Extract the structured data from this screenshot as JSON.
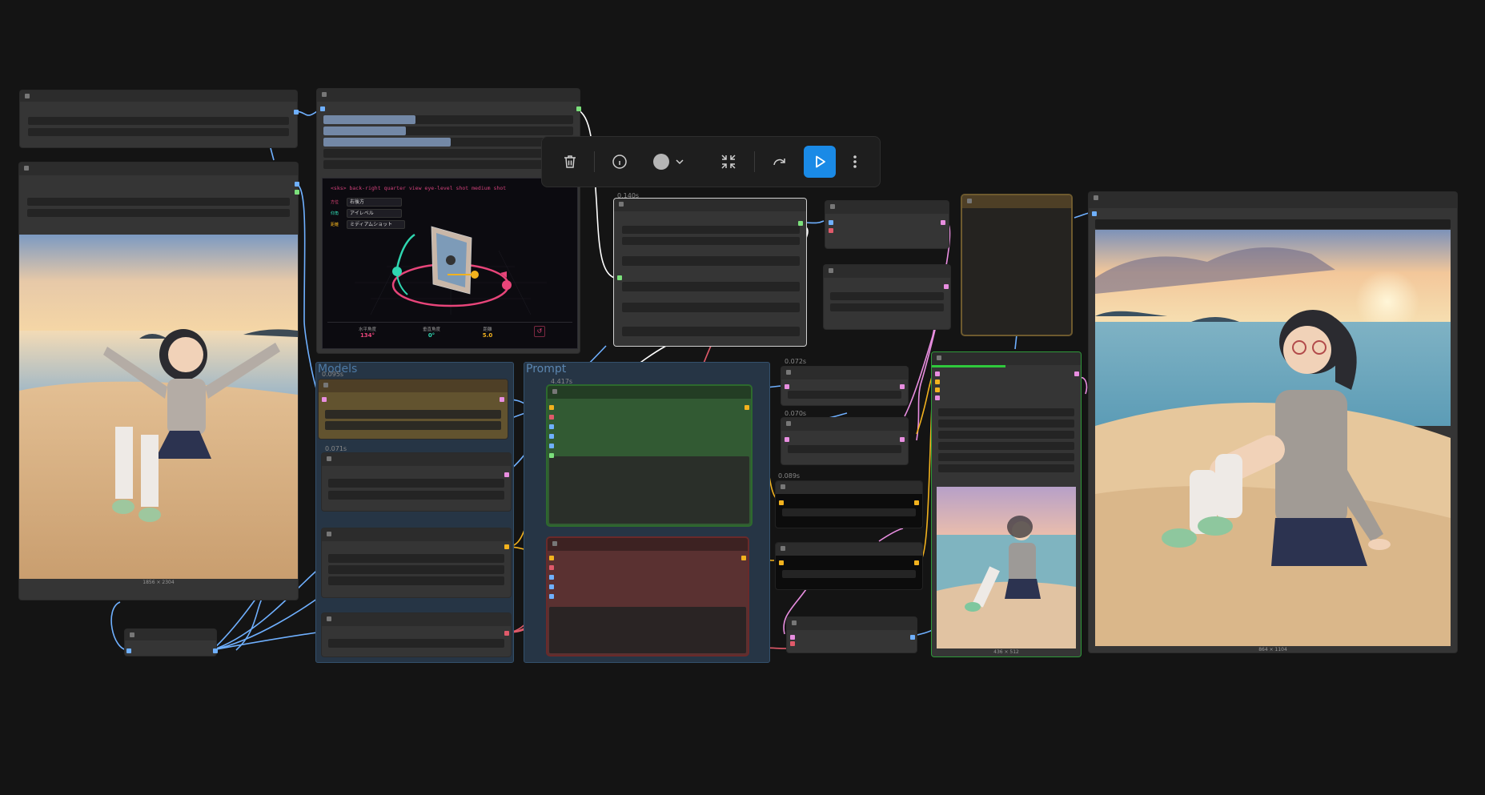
{
  "toolbar": {
    "buttons": [
      {
        "name": "delete",
        "icon": "trash-icon"
      },
      {
        "name": "info",
        "icon": "info-icon"
      },
      {
        "name": "color",
        "icon": "color-circle-icon"
      },
      {
        "name": "fit",
        "icon": "collapse-icon"
      },
      {
        "name": "bypass",
        "icon": "redo-arrow-icon"
      },
      {
        "name": "run",
        "icon": "play-icon"
      },
      {
        "name": "more",
        "icon": "more-vertical-icon"
      }
    ],
    "accent": "#1a8ae6"
  },
  "groups": {
    "models": "Models",
    "prompt": "Prompt"
  },
  "timings": {
    "models_node": "0.095s",
    "lora_node": "0.071s",
    "prompt_node": "4.417s",
    "mid_node": "0.140s",
    "enc_a": "0.072s",
    "enc_b": "0.070s",
    "black_node": "0.089s"
  },
  "camera": {
    "prompt_text": "<sks> back-right quarter view eye-level shot medium shot",
    "rows": [
      {
        "key": "方位",
        "value": "右後方"
      },
      {
        "key": "仰角",
        "value": "アイレベル"
      },
      {
        "key": "距離",
        "value": "ミディアムショット"
      }
    ],
    "stats": [
      {
        "label": "水平角度",
        "value": "134°",
        "color": "#e8457a"
      },
      {
        "label": "垂直角度",
        "value": "0°",
        "color": "#2fd6b0"
      },
      {
        "label": "距離",
        "value": "5.0",
        "color": "#f2b21e"
      }
    ]
  },
  "captions": {
    "left_image": "1856 × 2304",
    "small_preview": "436 × 512",
    "right_image": "864 × 1104"
  },
  "colors": {
    "canvas": "#141414",
    "node": "#353535",
    "group_blue": "#2a3f55",
    "green_node": "#325a33",
    "red_node": "#5a3131",
    "brown_node": "#5a4a2a",
    "wire_blue": "#6fb0ff",
    "wire_yellow": "#f2b21e",
    "wire_pink": "#e88ee0",
    "wire_red": "#e05a6a"
  }
}
